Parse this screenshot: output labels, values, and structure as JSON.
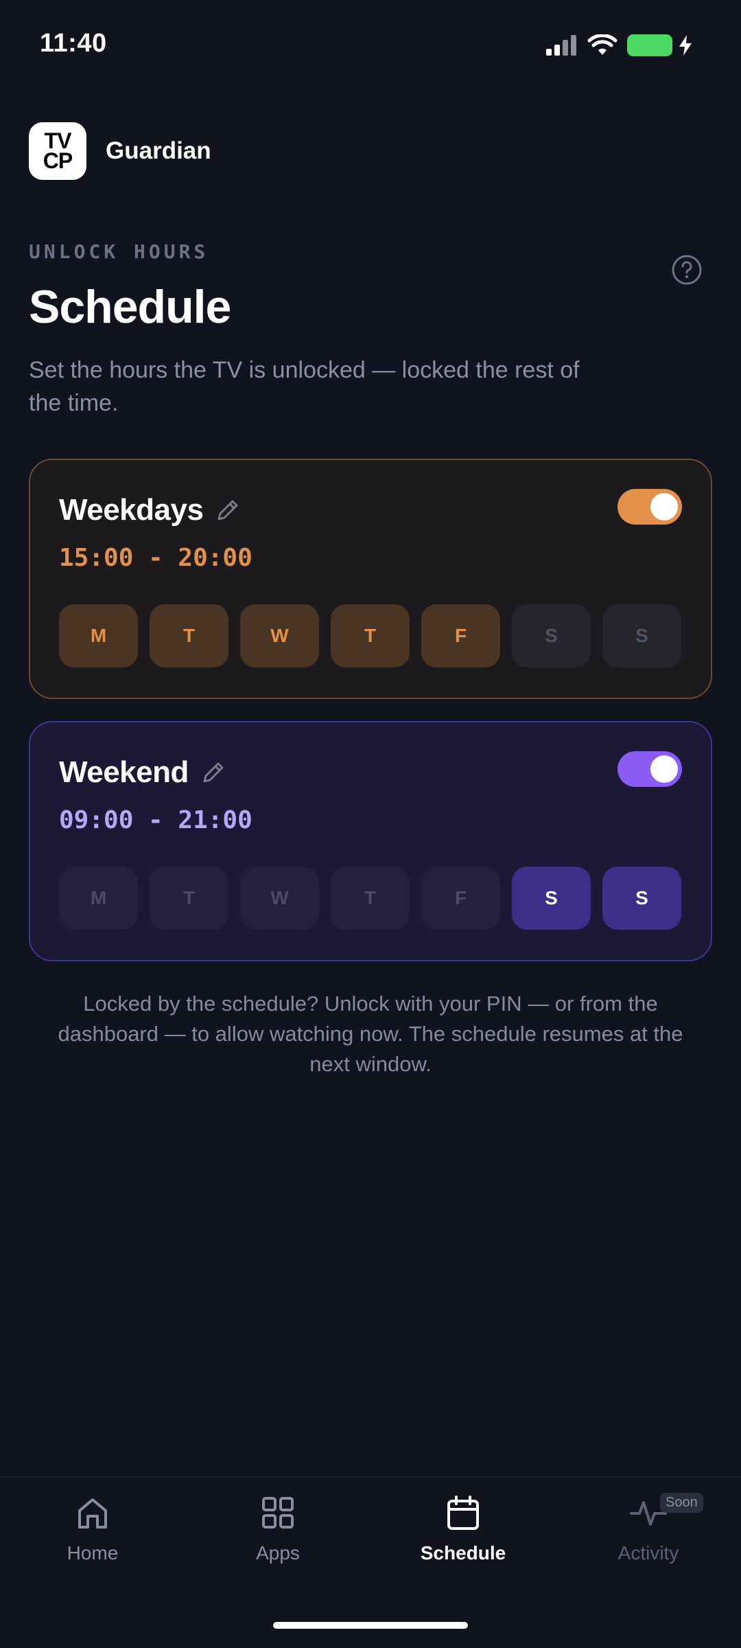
{
  "status_bar": {
    "time": "11:40",
    "battery_color": "#4cd964"
  },
  "header": {
    "logo_text_line1": "TV",
    "logo_text_line2": "CP",
    "app_name": "Guardian"
  },
  "page": {
    "eyebrow": "UNLOCK HOURS",
    "title": "Schedule",
    "description": "Set the hours the TV is unlocked — locked the rest of the time."
  },
  "schedules": [
    {
      "name": "Weekdays",
      "enabled": true,
      "time_range": "15:00 - 20:00",
      "accent_color": "#e3914a",
      "days": [
        {
          "label": "M",
          "active": true
        },
        {
          "label": "T",
          "active": true
        },
        {
          "label": "W",
          "active": true
        },
        {
          "label": "T",
          "active": true
        },
        {
          "label": "F",
          "active": true
        },
        {
          "label": "S",
          "active": false
        },
        {
          "label": "S",
          "active": false
        }
      ]
    },
    {
      "name": "Weekend",
      "enabled": true,
      "time_range": "09:00 - 21:00",
      "accent_color": "#8b5cf6",
      "days": [
        {
          "label": "M",
          "active": false
        },
        {
          "label": "T",
          "active": false
        },
        {
          "label": "W",
          "active": false
        },
        {
          "label": "T",
          "active": false
        },
        {
          "label": "F",
          "active": false
        },
        {
          "label": "S",
          "active": true
        },
        {
          "label": "S",
          "active": true
        }
      ]
    }
  ],
  "footnote": "Locked by the schedule? Unlock with your PIN — or from the dashboard — to allow watching now. The schedule resumes at the next window.",
  "nav": {
    "items": [
      {
        "label": "Home",
        "icon": "home-icon",
        "state": "default"
      },
      {
        "label": "Apps",
        "icon": "apps-grid-icon",
        "state": "default"
      },
      {
        "label": "Schedule",
        "icon": "calendar-icon",
        "state": "active"
      },
      {
        "label": "Activity",
        "icon": "activity-pulse-icon",
        "state": "disabled",
        "badge": "Soon"
      }
    ]
  }
}
